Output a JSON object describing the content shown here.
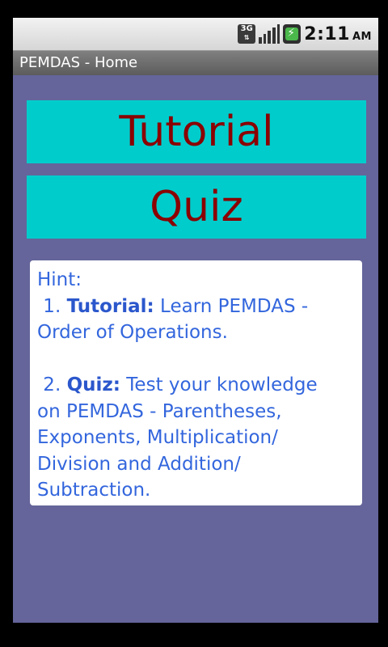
{
  "status_bar": {
    "network": "3G",
    "time": "2:11",
    "ampm": "AM"
  },
  "app": {
    "title": "PEMDAS - Home"
  },
  "buttons": {
    "tutorial": "Tutorial",
    "quiz": "Quiz"
  },
  "hint": {
    "heading": "Hint:",
    "item1_prefix": " 1. ",
    "item1_bold": "Tutorial:",
    "item1_text_line1": " Learn PEMDAS -",
    "item1_text_line2": "Order of Operations.",
    "item2_prefix": " 2. ",
    "item2_bold": "Quiz:",
    "item2_text_line1": " Test your knowledge",
    "item2_text_line2": "on PEMDAS - Parentheses,",
    "item2_text_line3": "Exponents, Multiplication/",
    "item2_text_line4": "Division and Addition/",
    "item2_text_line5": "Subtraction."
  },
  "colors": {
    "background": "#65659b",
    "button_bg": "#00cccc",
    "button_text": "#8b0000",
    "hint_text": "#3366dd"
  }
}
